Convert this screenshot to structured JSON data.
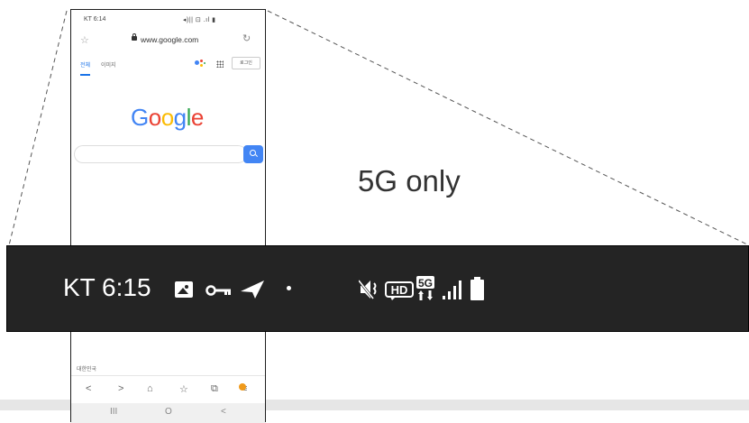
{
  "phone": {
    "status_bar": {
      "time": "KT 6:14",
      "icons_left": "✉ ✈ ▮",
      "icons_right": "× |||| ·"
    },
    "browser": {
      "url": "www.google.com"
    },
    "google": {
      "tab_all": "전체",
      "tab_images": "이미지",
      "sign_in": "로그인",
      "logo_letters": [
        "G",
        "o",
        "o",
        "g",
        "l",
        "e"
      ],
      "logo_colors": [
        "#4285f4",
        "#ea4335",
        "#fbbc05",
        "#4285f4",
        "#34a853",
        "#ea4335"
      ]
    },
    "footer": {
      "region": "대한민국"
    },
    "nav": {
      "back": "<",
      "forward": ">",
      "tabs_badge": ""
    },
    "system_nav": {
      "recents": "III",
      "home": "O",
      "back": "<"
    }
  },
  "caption": "5G only",
  "zoomed_status_bar": {
    "carrier_time": "KT 6:15",
    "left_icons": [
      "image-icon",
      "key-icon",
      "send-icon",
      "dot-icon"
    ],
    "right_icons": [
      "mute-icon",
      "hd-voice-icon",
      "5g-icon",
      "signal-icon",
      "battery-icon"
    ],
    "network_label": "5G",
    "hd_label": "HD"
  }
}
